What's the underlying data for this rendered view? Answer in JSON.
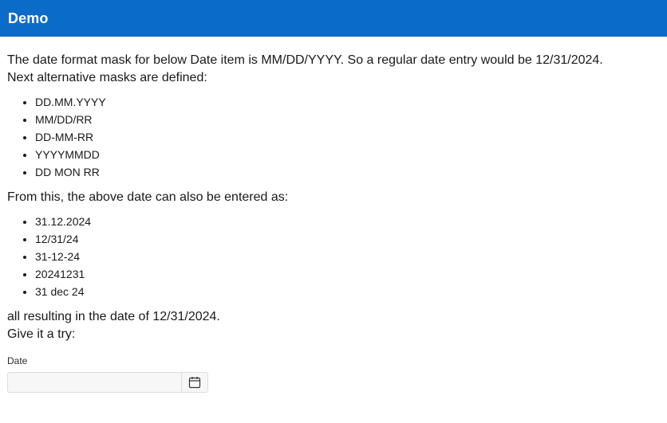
{
  "header": {
    "title": "Demo"
  },
  "intro": {
    "line1": "The date format mask for below Date item is MM/DD/YYYY. So a regular date entry would be 12/31/2024.",
    "line2": "Next alternative masks are defined:"
  },
  "masks": [
    "DD.MM.YYYY",
    "MM/DD/RR",
    "DD-MM-RR",
    "YYYYMMDD",
    "DD MON RR"
  ],
  "examples_intro": "From this, the above date can also be entered as:",
  "examples": [
    "31.12.2024",
    "12/31/24",
    "31-12-24",
    "20241231",
    "31 dec 24"
  ],
  "outro": {
    "line1": "all resulting in the date of 12/31/2024.",
    "line2": "Give it a try:"
  },
  "date_field": {
    "label": "Date",
    "value": "",
    "icon": "calendar-icon"
  },
  "colors": {
    "header_bg": "#0a6bc9",
    "header_text": "#ffffff"
  }
}
